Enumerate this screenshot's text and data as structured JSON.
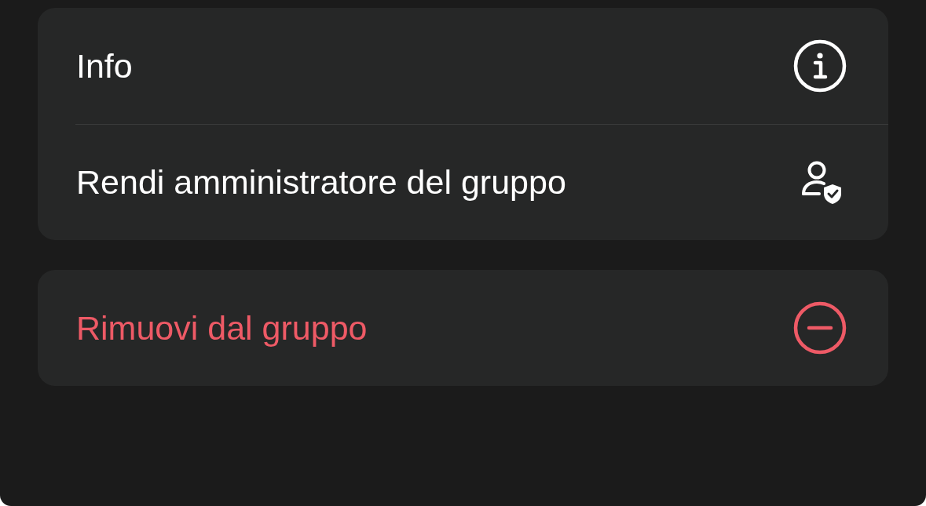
{
  "menu_groups": [
    {
      "items": [
        {
          "label": "Info",
          "kind": "info",
          "destructive": false
        },
        {
          "label": "Rendi amministratore del gruppo",
          "kind": "admin",
          "destructive": false
        }
      ]
    },
    {
      "items": [
        {
          "label": "Rimuovi dal gruppo",
          "kind": "remove",
          "destructive": true
        }
      ]
    }
  ]
}
